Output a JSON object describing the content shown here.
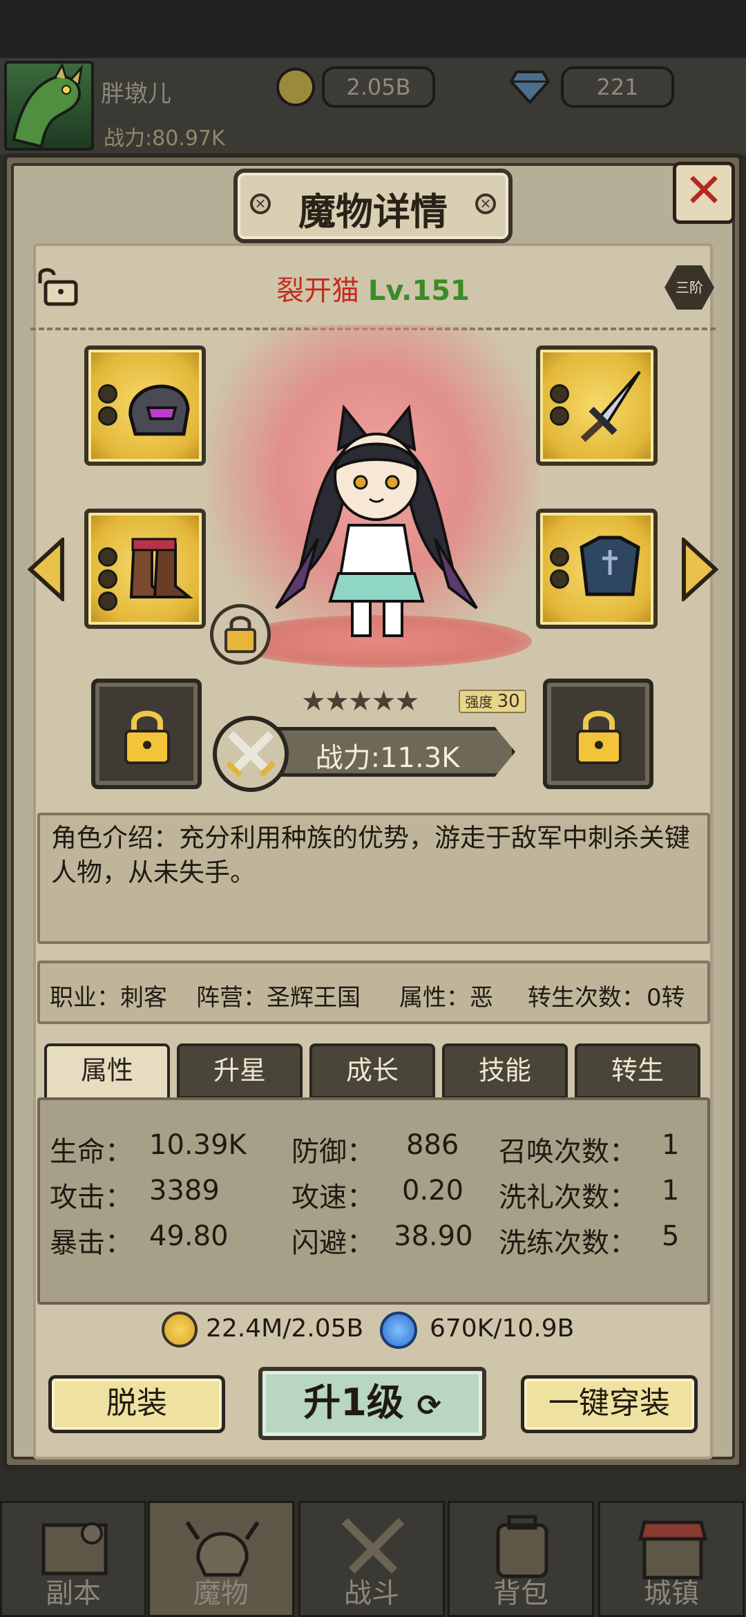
{
  "player": {
    "name": "胖墩儿",
    "power": "战力:80.97K"
  },
  "currency": {
    "gold": "2.05B",
    "gems": "221"
  },
  "panel": {
    "title": "魔物详情",
    "close": "✕",
    "tier": "三阶"
  },
  "monster": {
    "name": "裂开猫",
    "level": "Lv.151",
    "stars": 5,
    "strength_label": "强度",
    "strength_value": "30",
    "power": "战力:11.3K",
    "intro": "角色介绍：充分利用种族的优势，游走于敌军中刺杀关键人物，从未失手。",
    "info": [
      {
        "label": "职业：",
        "value": "刺客"
      },
      {
        "label": "阵营：",
        "value": "圣辉王国"
      },
      {
        "label": "属性：",
        "value": "恶"
      },
      {
        "label": "转生次数：",
        "value": "0转"
      }
    ]
  },
  "equipment": {
    "helmet": {
      "name": "helmet",
      "sockets": 2
    },
    "weapon": {
      "name": "sword",
      "sockets": 2
    },
    "boots": {
      "name": "boots",
      "sockets": 3
    },
    "armor": {
      "name": "armor",
      "sockets": 2
    }
  },
  "tabs": [
    "属性",
    "升星",
    "成长",
    "技能",
    "转生"
  ],
  "active_tab": "属性",
  "stats": [
    {
      "label": "生命：",
      "value": "10.39K"
    },
    {
      "label": "防御：",
      "value": "886"
    },
    {
      "label": "召唤次数：",
      "value": "1"
    },
    {
      "label": "攻击：",
      "value": "3389"
    },
    {
      "label": "攻速：",
      "value": "0.20"
    },
    {
      "label": "洗礼次数：",
      "value": "1"
    },
    {
      "label": "暴击：",
      "value": "49.80"
    },
    {
      "label": "闪避：",
      "value": "38.90"
    },
    {
      "label": "洗练次数：",
      "value": "5"
    }
  ],
  "upgrade_cost": {
    "gold": "22.4M/2.05B",
    "essence": "670K/10.9B"
  },
  "buttons": {
    "unequip": "脱装",
    "level_up": "升1级",
    "auto_equip": "一键穿装"
  },
  "nav": [
    "副本",
    "魔物",
    "战斗",
    "背包",
    "城镇"
  ],
  "nav_active": "魔物",
  "colors": {
    "name_red": "#c62a1f",
    "level_green": "#3b8c28",
    "slot_gold": "#e3b83a"
  }
}
